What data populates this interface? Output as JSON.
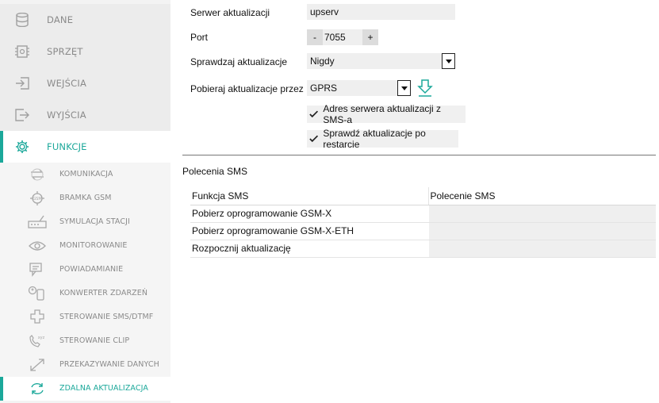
{
  "sidebar": {
    "main_items": [
      {
        "label": "DANE",
        "icon": "database-icon"
      },
      {
        "label": "SPRZĘT",
        "icon": "chip-icon"
      },
      {
        "label": "WEJŚCIA",
        "icon": "input-icon"
      },
      {
        "label": "WYJŚCIA",
        "icon": "output-icon"
      },
      {
        "label": "FUNKCJE",
        "icon": "gear-icon"
      }
    ],
    "sub_items": [
      {
        "label": "KOMUNIKACJA",
        "icon": "arrows-icon"
      },
      {
        "label": "BRAMKA GSM",
        "icon": "gsm-icon"
      },
      {
        "label": "SYMULACJA STACJI",
        "icon": "station-icon"
      },
      {
        "label": "MONITOROWANIE",
        "icon": "eye-icon"
      },
      {
        "label": "POWIADAMIANIE",
        "icon": "chat-icon"
      },
      {
        "label": "KONWERTER ZDARZEŃ",
        "icon": "converter-icon"
      },
      {
        "label": "STEROWANIE SMS/DTMF",
        "icon": "dpad-icon"
      },
      {
        "label": "STEROWANIE CLIP",
        "icon": "phone-icon"
      },
      {
        "label": "PRZEKAZYWANIE DANYCH",
        "icon": "transfer-icon"
      },
      {
        "label": "ZDALNA AKTUALIZACJA",
        "icon": "refresh-icon"
      }
    ],
    "accent": "#1ba89a"
  },
  "form": {
    "server_label": "Serwer aktualizacji",
    "server_value": "upserv",
    "port_label": "Port",
    "port_minus": "-",
    "port_value": "7055",
    "port_plus": "+",
    "check_label": "Sprawdzaj aktualizacje",
    "check_value": "Nigdy",
    "download_label": "Pobieraj aktualizacje przez",
    "download_value": "GPRS",
    "sms_server_checkbox": "Adres serwera aktualizacji z SMS-a",
    "restart_checkbox": "Sprawdź aktualizacje po restarcie"
  },
  "sms_commands": {
    "title": "Polecenia SMS",
    "headers": [
      "Funkcja SMS",
      "Polecenie SMS"
    ],
    "rows": [
      {
        "function": "Pobierz oprogramowanie GSM-X",
        "command": ""
      },
      {
        "function": "Pobierz oprogramowanie GSM-X-ETH",
        "command": ""
      },
      {
        "function": "Rozpocznij aktualizację",
        "command": ""
      }
    ]
  }
}
